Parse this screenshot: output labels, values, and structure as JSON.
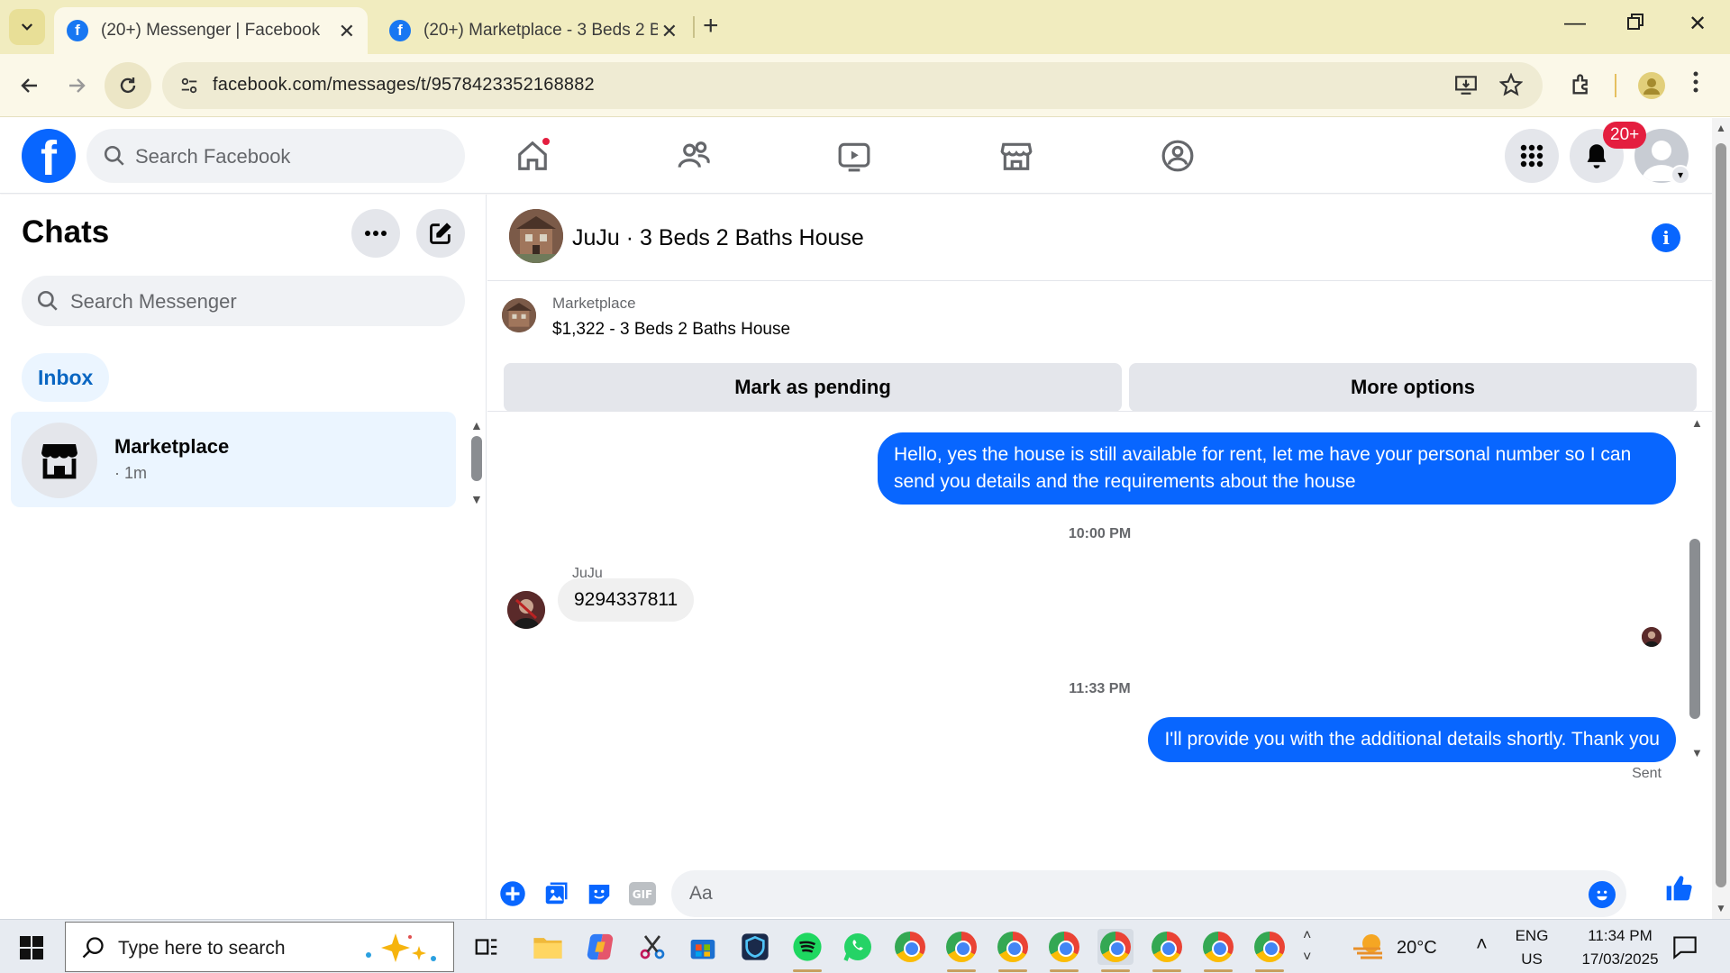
{
  "browser": {
    "tabs": [
      {
        "title": "(20+) Messenger | Facebook",
        "active": true
      },
      {
        "title": "(20+) Marketplace - 3 Beds 2 Ba",
        "active": false
      }
    ],
    "url": "facebook.com/messages/t/9578423352168882"
  },
  "facebook": {
    "search_placeholder": "Search Facebook",
    "notification_badge": "20+"
  },
  "sidebar": {
    "title": "Chats",
    "search_placeholder": "Search Messenger",
    "filter": "Inbox",
    "conversations": [
      {
        "name": "Marketplace",
        "time": "· 1m"
      }
    ]
  },
  "conversation": {
    "title": "JuJu · 3 Beds 2 Baths House",
    "marketplace_label": "Marketplace",
    "listing": "$1,322 - 3 Beds 2 Baths House",
    "mark_pending_label": "Mark as pending",
    "more_options_label": "More options",
    "messages": [
      {
        "from": "me",
        "text": "Hello, yes the house is still available for rent, let me have your personal number so I can send you details and the requirements about the house"
      },
      {
        "type": "timestamp",
        "text": "10:00 PM"
      },
      {
        "from": "JuJu",
        "sender_name": "JuJu",
        "text": "9294337811"
      },
      {
        "type": "timestamp",
        "text": "11:33 PM"
      },
      {
        "from": "me",
        "text": "I'll provide you with the additional details shortly. Thank you",
        "status": "Sent"
      }
    ],
    "composer_placeholder": "Aa"
  },
  "taskbar": {
    "search_placeholder": "Type here to search",
    "weather": "20°C",
    "language": "ENG",
    "region": "US",
    "time": "11:34 PM",
    "date": "17/03/2025"
  },
  "colors": {
    "facebook_blue": "#0866ff",
    "badge_red": "#e41e3f",
    "chrome_tabbar": "#f1ecbf"
  }
}
